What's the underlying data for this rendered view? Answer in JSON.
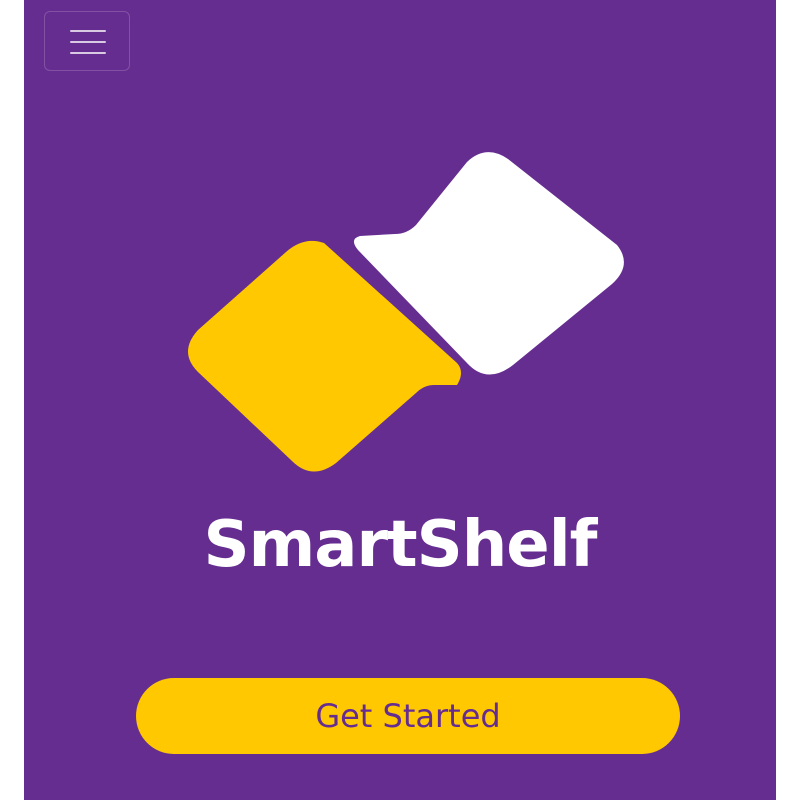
{
  "theme": {
    "background": "#662d91",
    "accent": "#ffc800",
    "logo_secondary": "#ffffff",
    "button_text": "#662d91"
  },
  "header": {
    "menu_icon": "hamburger-menu-icon"
  },
  "logo": {
    "icon": "two-interlocking-speech-bubbles-icon"
  },
  "brand": {
    "name": "SmartShelf"
  },
  "cta": {
    "label": "Get Started"
  }
}
